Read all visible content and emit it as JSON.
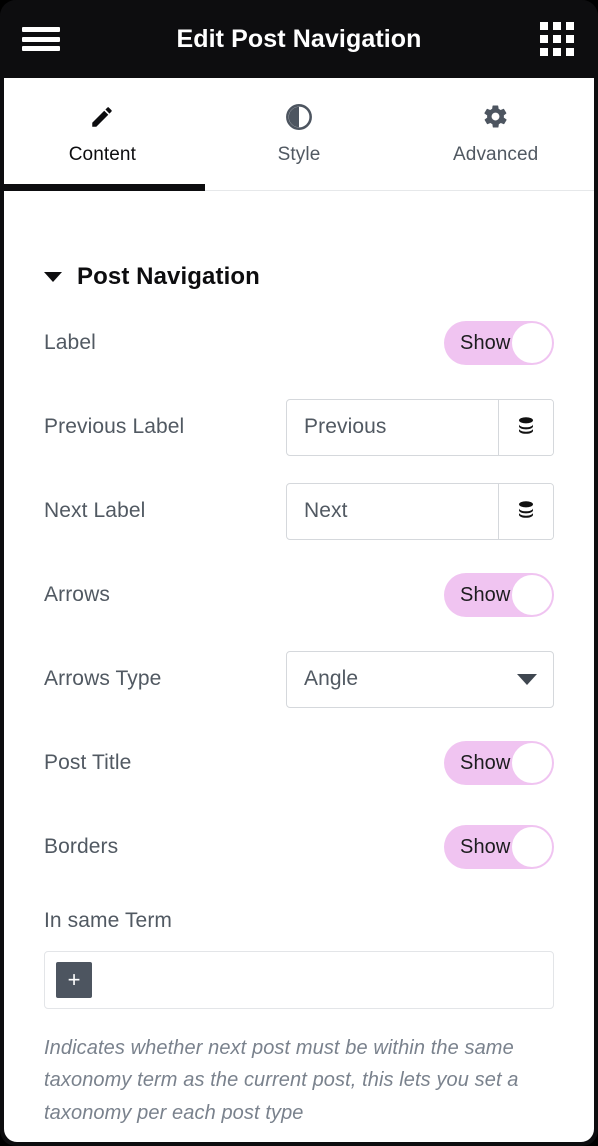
{
  "topbar": {
    "menu_icon": "hamburger-icon",
    "title": "Edit Post Navigation",
    "apps_icon": "grid-apps-icon"
  },
  "tabs": [
    {
      "label": "Content",
      "icon": "pencil-icon",
      "active": true
    },
    {
      "label": "Style",
      "icon": "contrast-icon",
      "active": false
    },
    {
      "label": "Advanced",
      "icon": "gear-icon",
      "active": false
    }
  ],
  "section": {
    "title": "Post Navigation",
    "expanded": true,
    "caret_icon": "caret-down-icon"
  },
  "controls": {
    "label_switch": {
      "label": "Label",
      "state": "Show"
    },
    "previous_label": {
      "label": "Previous Label",
      "value": "Previous",
      "dynamic_icon": "database-stack-icon"
    },
    "next_label": {
      "label": "Next Label",
      "value": "Next",
      "dynamic_icon": "database-stack-icon"
    },
    "arrows_switch": {
      "label": "Arrows",
      "state": "Show"
    },
    "arrows_type": {
      "label": "Arrows Type",
      "value": "Angle",
      "caret_icon": "select-caret-down-icon"
    },
    "post_title_switch": {
      "label": "Post Title",
      "state": "Show"
    },
    "borders_switch": {
      "label": "Borders",
      "state": "Show"
    },
    "in_same_term": {
      "label": "In same Term",
      "add_label": "+",
      "description": "Indicates whether next post must be within the same taxonomy term as the current post, this lets you set a taxonomy per each post type"
    }
  },
  "colors": {
    "topbar_bg": "#0d0d0f",
    "panel_bg": "#ffffff",
    "switch_on": "#f0c4f1",
    "label_text": "#515962",
    "helper_text": "#7a828d",
    "border": "#d5d8dc",
    "add_button_bg": "#4d5560"
  }
}
